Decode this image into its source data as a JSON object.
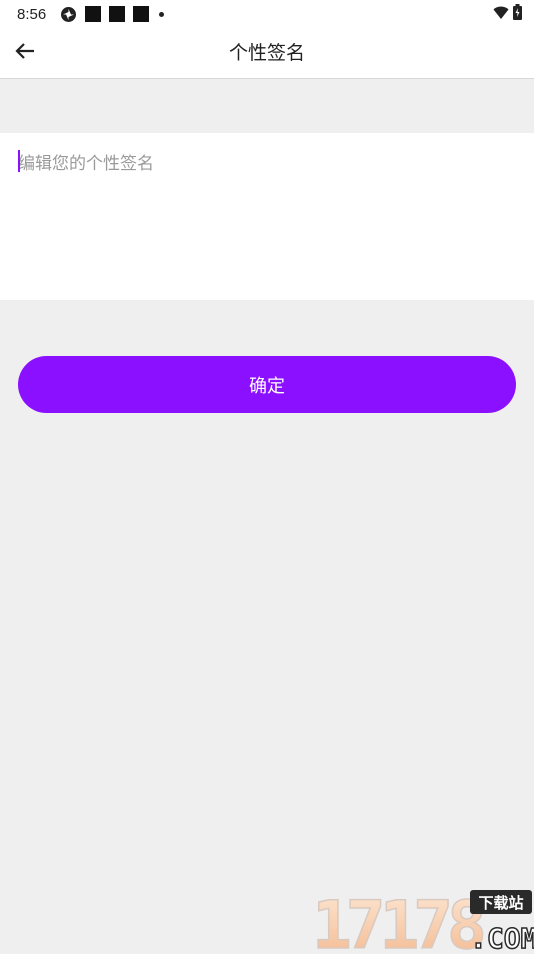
{
  "status_bar": {
    "time": "8:56",
    "icons": [
      "sync-icon",
      "notification-square-icon",
      "notification-square-icon",
      "notification-square-icon",
      "dot-icon",
      "wifi-icon",
      "battery-icon"
    ]
  },
  "header": {
    "title": "个性签名",
    "back_icon": "arrow-left-icon"
  },
  "signature": {
    "placeholder": "编辑您的个性签名",
    "value": ""
  },
  "confirm": {
    "label": "确定"
  },
  "colors": {
    "accent": "#8b10ff",
    "background": "#efefef",
    "surface": "#ffffff"
  },
  "watermark": {
    "number_text": "17178",
    "badge_text": "下载站",
    "suffix_text": ".COM"
  }
}
